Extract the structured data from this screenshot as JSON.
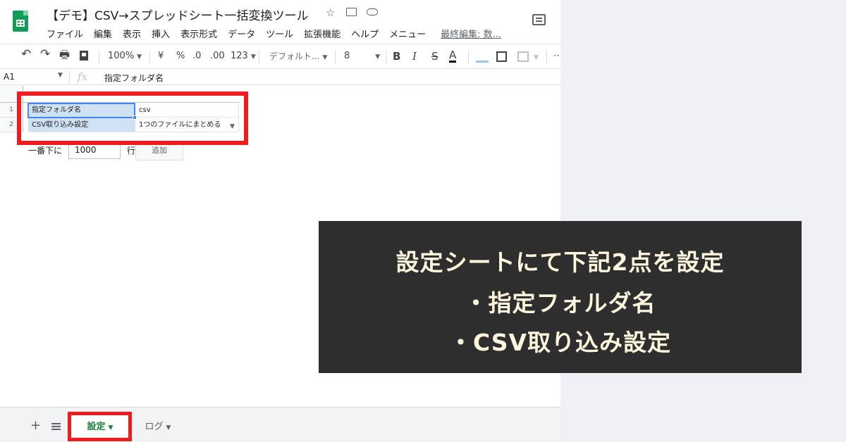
{
  "title_bar": {
    "doc_title": "【デモ】CSV→スプレッドシート一括変換ツール",
    "star_icon": "☆",
    "menu": [
      "ファイル",
      "編集",
      "表示",
      "挿入",
      "表示形式",
      "データ",
      "ツール",
      "拡張機能",
      "ヘルプ",
      "メニュー"
    ],
    "last_edit": "最終編集: 数..."
  },
  "toolbar": {
    "undo": "↶",
    "redo": "↷",
    "print": "🖶",
    "zoom": "100%",
    "currency": "¥",
    "percent": "%",
    "decrease_decimal": ".0",
    "increase_decimal": ".00",
    "number_format": "123",
    "font": "デフォルト...",
    "font_size": "8",
    "bold": "B",
    "italic": "I",
    "strike": "S",
    "text_color": "A",
    "more": "⋯"
  },
  "formula_bar": {
    "cell_ref": "A1",
    "fx": "fx",
    "value": "指定フォルダ名"
  },
  "grid": {
    "rows": [
      {
        "num": "1",
        "a": "指定フォルダ名",
        "b": "csv"
      },
      {
        "num": "2",
        "a": "CSV取り込み設定",
        "b": "1つのファイルにまとめる"
      }
    ],
    "add_rows": {
      "label": "一番下に",
      "count": "1000",
      "unit": "行",
      "button": "追加"
    }
  },
  "sheet_tabs": {
    "add": "+",
    "tabs": [
      {
        "label": "設定",
        "active": true
      },
      {
        "label": "ログ",
        "active": false
      }
    ]
  },
  "callout": {
    "line1": "設定シートにて下記2点を設定",
    "line2": "・指定フォルダ名",
    "line3": "・CSV取り込み設定"
  },
  "colors": {
    "highlight_red": "#ee1c1c",
    "callout_bg": "#2e2e2e",
    "callout_text": "#fff6de",
    "sheets_green": "#0f9d58",
    "selected_cell_fill": "#cfe2f3"
  }
}
